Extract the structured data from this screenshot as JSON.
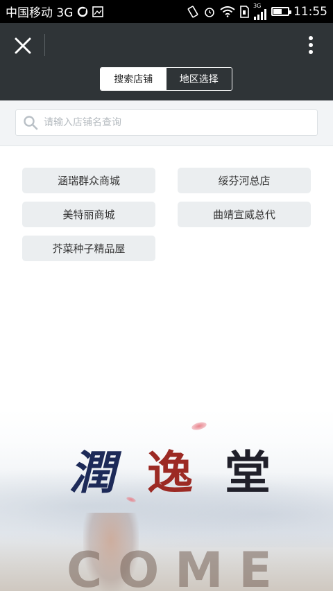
{
  "status_bar": {
    "carrier": "中国移动 3G",
    "network_small": "3G",
    "time": "11:55",
    "battery_level": 0.55
  },
  "header": {
    "tabs": [
      {
        "label": "搜索店铺",
        "active": true
      },
      {
        "label": "地区选择",
        "active": false
      }
    ]
  },
  "search": {
    "placeholder": "请输入店铺名查询",
    "value": ""
  },
  "stores": [
    {
      "label": "涵瑞群众商城"
    },
    {
      "label": "绥芬河总店"
    },
    {
      "label": "美特丽商城"
    },
    {
      "label": "曲靖宣威总代"
    },
    {
      "label": "芥菜种子精品屋"
    }
  ],
  "banner": {
    "logo": [
      "潤",
      "逸",
      "堂"
    ],
    "come": [
      "C",
      "O",
      "M",
      "E"
    ]
  },
  "colors": {
    "header_bg": "#2f3437",
    "store_btn_bg": "#ebeef0",
    "search_area_bg": "#f2f4f6"
  },
  "icons": {
    "close": "close-icon",
    "more": "more-vertical-icon",
    "search": "search-icon"
  }
}
